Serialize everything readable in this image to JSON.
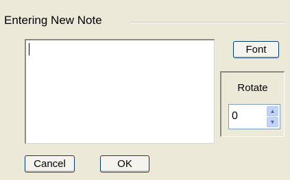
{
  "dialog": {
    "group_title": "Entering New Note"
  },
  "note": {
    "value": ""
  },
  "buttons": {
    "font_label": "Font",
    "cancel_label": "Cancel",
    "ok_label": "OK"
  },
  "rotate": {
    "label": "Rotate",
    "value": "0",
    "up_icon": "▲",
    "down_icon": "▼"
  }
}
